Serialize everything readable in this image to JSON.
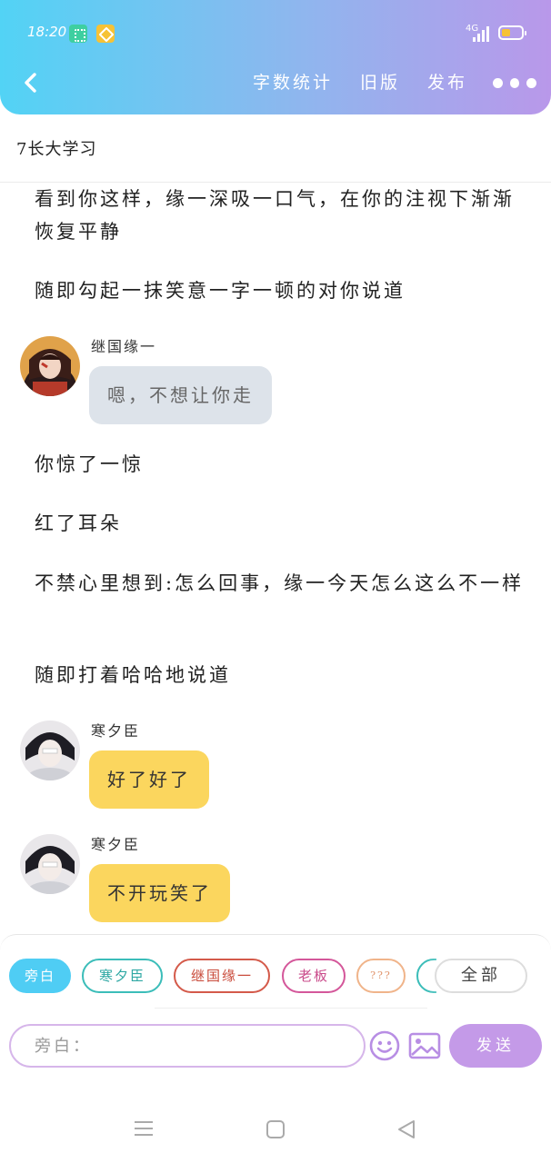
{
  "status": {
    "time": "18:20",
    "network": "4G"
  },
  "nav": {
    "links": [
      "字数统计",
      "旧版",
      "发布"
    ]
  },
  "doc": {
    "title": "7长大学习"
  },
  "content": {
    "n1": "看到你这样，缘一深吸一口气，在你的注视下渐渐恢复平静",
    "n2": "随即勾起一抹笑意一字一顿的对你说道",
    "m1": {
      "name": "继国缘一",
      "text": "嗯，不想让你走"
    },
    "n3": "你惊了一惊",
    "n4": "红了耳朵",
    "n5": "不禁心里想到:怎么回事，缘一今天怎么这么不一样",
    "n6": "随即打着哈哈地说道",
    "m2": {
      "name": "寒夕臣",
      "text": "好了好了"
    },
    "m3": {
      "name": "寒夕臣",
      "text": "不开玩笑了"
    }
  },
  "chips": [
    "旁白",
    "寒夕臣",
    "继国缘一",
    "老板",
    "???"
  ],
  "chip_all": "全部",
  "input": {
    "placeholder": "旁白："
  },
  "send_label": "发送",
  "colors": {
    "chip_active": "#4fcdf4",
    "chip_teal": "#3bbdb9",
    "chip_red": "#d45a4a",
    "chip_pink": "#d4579a",
    "chip_orange": "#f0b48a",
    "bubble_yellow": "#fbd65e",
    "bubble_grey": "#dde3ea",
    "send": "#c49ae8"
  }
}
